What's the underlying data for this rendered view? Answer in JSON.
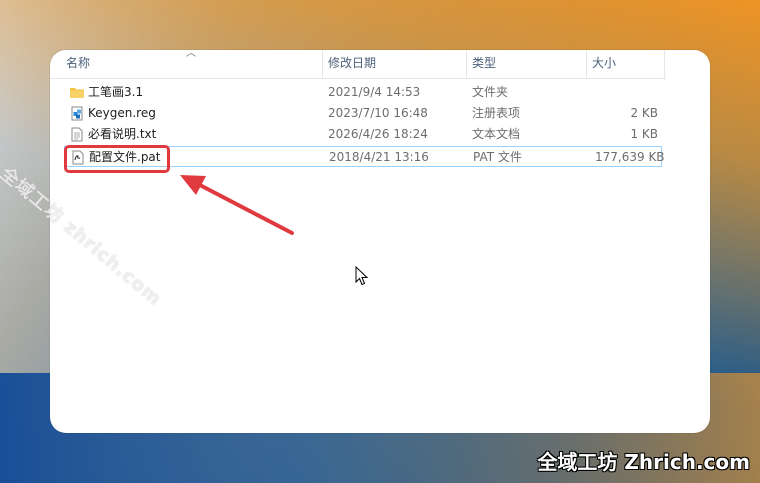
{
  "colors": {
    "accent_red": "#e0393e",
    "selection_border": "#99d1ff",
    "header_text": "#4c607a",
    "folder_yellow": "#f5c242"
  },
  "columns": {
    "name": "名称",
    "date": "修改日期",
    "type": "类型",
    "size": "大小"
  },
  "files": [
    {
      "name": "工笔画3.1",
      "date": "2021/9/4 14:53",
      "type": "文件夹",
      "size": "",
      "icon": "folder-icon"
    },
    {
      "name": "Keygen.reg",
      "date": "2023/7/10 16:48",
      "type": "注册表项",
      "size": "2 KB",
      "icon": "registry-icon"
    },
    {
      "name": "必看说明.txt",
      "date": "2026/4/26 18:24",
      "type": "文本文档",
      "size": "1 KB",
      "icon": "text-file-icon"
    },
    {
      "name": "配置文件.pat",
      "date": "2018/4/21 13:16",
      "type": "PAT 文件",
      "size": "177,639 KB",
      "icon": "pat-file-icon"
    }
  ],
  "watermark": {
    "diagonal": "全域工坊 zhrich.com",
    "corner": "全域工坊 Zhrich.com"
  }
}
